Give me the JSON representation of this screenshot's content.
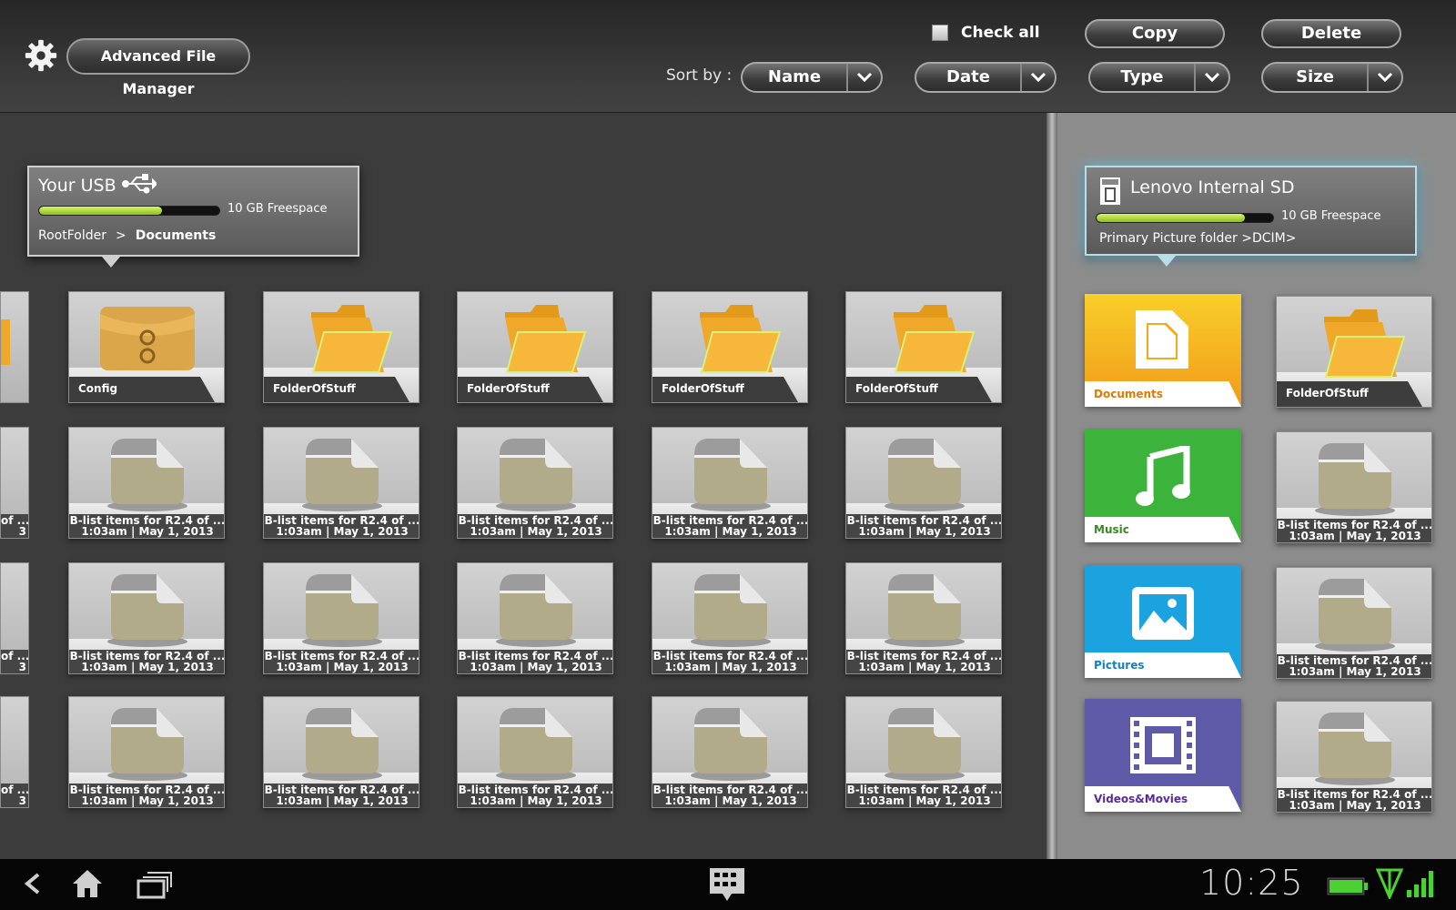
{
  "app": {
    "title": "Advanced File Manager"
  },
  "toolbar": {
    "check_all": "Check all",
    "copy": "Copy",
    "delete": "Delete",
    "sort_by": "Sort by :",
    "sort_options": [
      "Name",
      "Date",
      "Type",
      "Size"
    ]
  },
  "usb": {
    "title": "Your USB",
    "freespace": "10 GB Freespace",
    "usage_fraction": 0.68,
    "crumb_root": "RootFolder",
    "crumb_sep": ">",
    "crumb_current": "Documents"
  },
  "sd": {
    "title": "Lenovo Internal SD",
    "freespace": "10 GB Freespace",
    "usage_fraction": 0.84,
    "subtitle": "Primary Picture folder >DCIM>"
  },
  "left_grid": {
    "folders": [
      "Config",
      "FolderOfStuff",
      "FolderOfStuff",
      "FolderOfStuff",
      "FolderOfStuff"
    ],
    "partial_caption": [
      "of ...",
      "3"
    ],
    "file_line1": "B-list items for R2.4 of ...",
    "file_line2": "1:03am | May 1, 2013"
  },
  "right_grid": {
    "categories": [
      {
        "label": "Documents",
        "color": "#f5a81c",
        "label_color": "#e07a00"
      },
      {
        "label": "Music",
        "color": "#3cb43c",
        "label_color": "#3a8a20"
      },
      {
        "label": "Pictures",
        "color": "#1aa3df",
        "label_color": "#1680c0"
      },
      {
        "label": "Videos&Movies",
        "color": "#5e5aa8",
        "label_color": "#5a2aa0"
      }
    ],
    "folder": "FolderOfStuff",
    "file_line1": "B-list items for R2.4 of ...",
    "file_line2": "1:03am | May 1, 2013"
  },
  "status": {
    "time": "10:25"
  }
}
